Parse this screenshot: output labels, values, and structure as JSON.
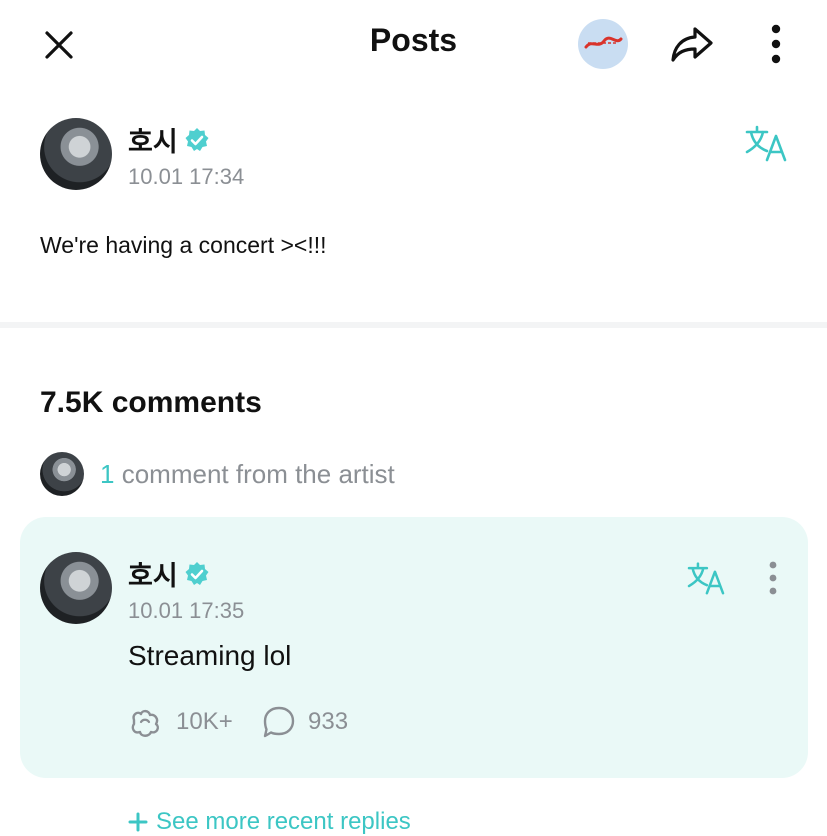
{
  "header": {
    "title": "Posts"
  },
  "post": {
    "author": "호시",
    "timestamp": "10.01 17:34",
    "text": "We're having a concert ><!!!"
  },
  "comments": {
    "count_label": "7.5K comments",
    "artist_count": "1",
    "artist_label": "comment from the artist",
    "featured": {
      "author": "호시",
      "timestamp": "10.01 17:35",
      "text": "Streaming lol",
      "likes": "10K+",
      "replies": "933"
    },
    "more_replies_label": "See more recent replies"
  },
  "colors": {
    "accent": "#3cc6c4",
    "card_bg": "#eaf9f7",
    "muted": "#8b8f94"
  }
}
